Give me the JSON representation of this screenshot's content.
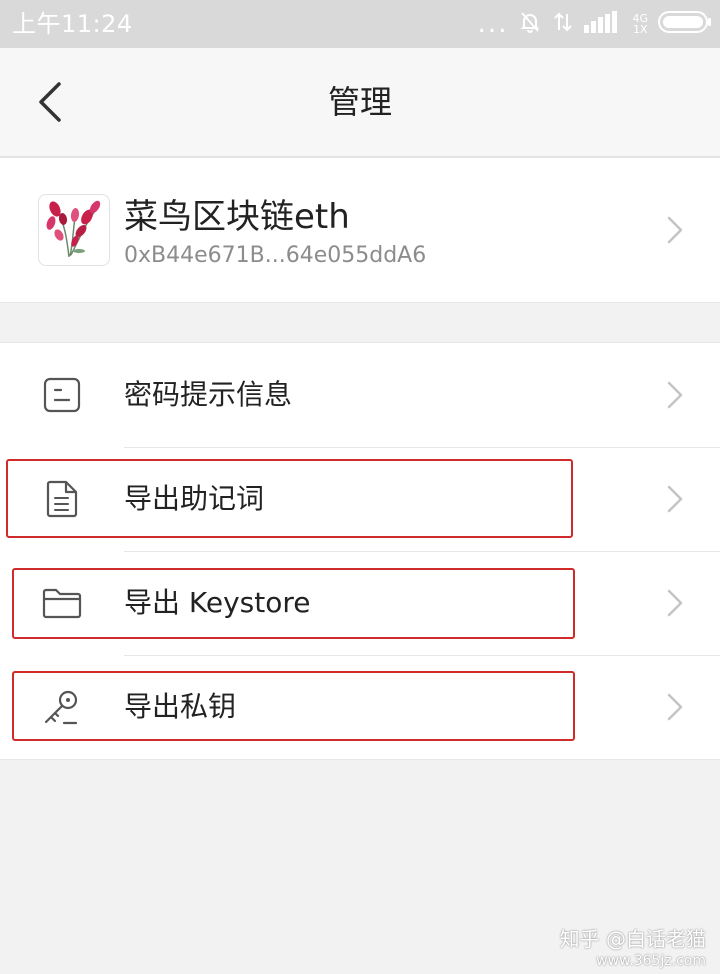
{
  "status_bar": {
    "time": "上午11:24",
    "more": "...",
    "net_top": "4G",
    "net_bottom": "1X"
  },
  "header": {
    "title": "管理"
  },
  "wallet": {
    "name": "菜鸟区块链eth",
    "address": "0xB44e671B...64e055ddA6"
  },
  "menu": {
    "items": [
      {
        "label": "密码提示信息",
        "icon": "note-icon"
      },
      {
        "label": "导出助记词",
        "icon": "document-icon"
      },
      {
        "label": "导出 Keystore",
        "icon": "folder-icon"
      },
      {
        "label": "导出私钥",
        "icon": "key-icon"
      }
    ]
  },
  "highlight_color": "#cf2b2b",
  "watermark": {
    "line1": "知乎 @白话老猫",
    "line2": "www.365jz.com"
  }
}
